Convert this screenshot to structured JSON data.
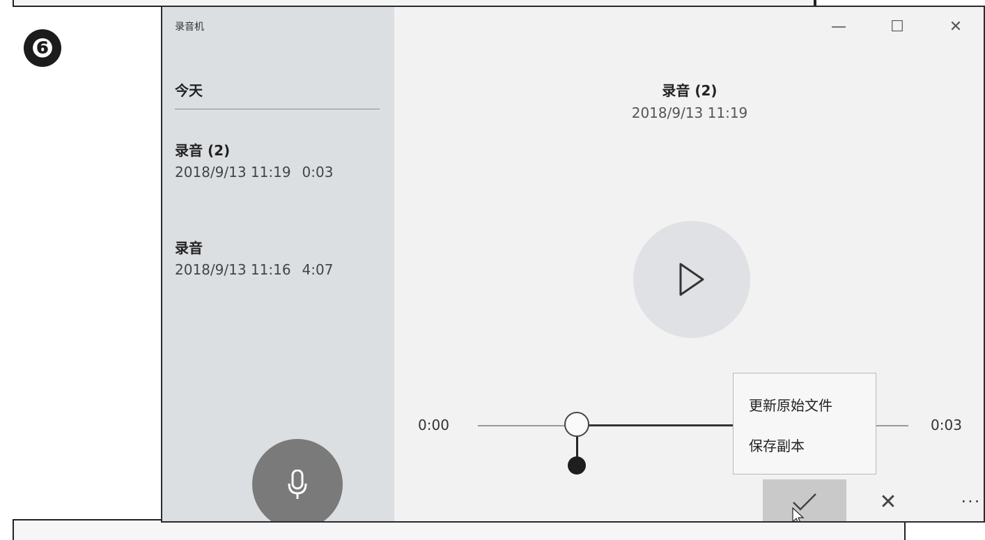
{
  "step_badge": "❻",
  "app": {
    "title": "录音机"
  },
  "window_controls": {
    "minimize": "—",
    "maximize": "☐",
    "close": "✕"
  },
  "sidebar": {
    "section_header": "今天",
    "recordings": [
      {
        "name": "录音 (2)",
        "date": "2018/9/13 11:19",
        "duration": "0:03"
      },
      {
        "name": "录音",
        "date": "2018/9/13 11:16",
        "duration": "4:07"
      }
    ]
  },
  "now_playing": {
    "title": "录音 (2)",
    "date": "2018/9/13 11:19"
  },
  "player": {
    "time_start": "0:00",
    "time_end": "0:03"
  },
  "context_menu": {
    "items": [
      "更新原始文件",
      "保存副本"
    ]
  },
  "bottom_bar": {
    "cancel": "✕",
    "more": "···"
  },
  "icons": {
    "microphone": "microphone-icon",
    "play": "play-icon",
    "check": "checkmark-icon",
    "cursor": "mouse-cursor-icon"
  },
  "colors": {
    "sidebar_bg": "#dcdfe2",
    "main_bg": "#f2f2f2",
    "mic_button": "#7a7a7a",
    "play_button": "#dfe1e4",
    "active_button": "#c9c9c9"
  }
}
